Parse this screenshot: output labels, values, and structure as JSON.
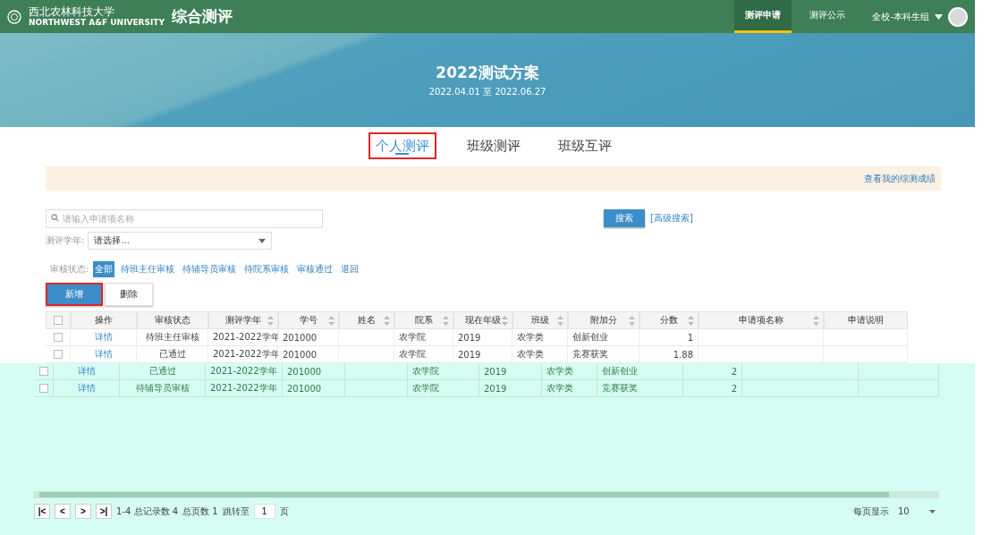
{
  "header": {
    "logo_cn": "西北农林科技大学",
    "logo_en": "NORTHWEST A&F UNIVERSITY",
    "app_title": "综合测评",
    "nav": [
      {
        "label": "测评申请",
        "selected": true
      },
      {
        "label": "测评公示",
        "selected": false
      }
    ],
    "user_group": "全校-本科生组"
  },
  "banner": {
    "title": "2022测试方案",
    "dates": "2022.04.01 至 2022.06.27"
  },
  "tabs": [
    {
      "label": "个人测评",
      "selected": true,
      "highlighted": true
    },
    {
      "label": "班级测评",
      "selected": false,
      "highlighted": false
    },
    {
      "label": "班级互评",
      "selected": false,
      "highlighted": false
    }
  ],
  "notice": {
    "link": "查看我的综测成绩"
  },
  "search": {
    "placeholder": "请输入申请项名称",
    "button": "搜索",
    "advanced": "[高级搜索]"
  },
  "year_filter": {
    "label": "测评学年:",
    "value": "请选择..."
  },
  "status_filter": {
    "label": "审核状态:",
    "options": [
      {
        "label": "全部",
        "selected": true
      },
      {
        "label": "待班主任审核",
        "selected": false
      },
      {
        "label": "待辅导员审核",
        "selected": false
      },
      {
        "label": "待院系审核",
        "selected": false
      },
      {
        "label": "审核通过",
        "selected": false
      },
      {
        "label": "退回",
        "selected": false
      }
    ]
  },
  "actions": [
    {
      "label": "新增",
      "kind": "primary",
      "highlighted": true
    },
    {
      "label": "删除",
      "kind": "default",
      "highlighted": false
    }
  ],
  "table": {
    "select_all_checked": false,
    "columns": [
      {
        "label": "操作",
        "sortable": false
      },
      {
        "label": "审核状态",
        "sortable": false
      },
      {
        "label": "测评学年",
        "sortable": true
      },
      {
        "label": "学号",
        "sortable": true
      },
      {
        "label": "姓名",
        "sortable": true
      },
      {
        "label": "院系",
        "sortable": true
      },
      {
        "label": "现在年级",
        "sortable": true
      },
      {
        "label": "班级",
        "sortable": true
      },
      {
        "label": "附加分",
        "sortable": true
      },
      {
        "label": "分数",
        "sortable": true
      },
      {
        "label": "申请项名称",
        "sortable": true
      },
      {
        "label": "申请说明",
        "sortable": false
      }
    ],
    "rows": [
      {
        "checked": false,
        "tinted": false,
        "cells": [
          "详情",
          "待班主任审核",
          "2021-2022学年",
          "201000",
          "",
          "农学院",
          "2019",
          "农学类",
          "创新创业",
          "1",
          "",
          ""
        ]
      },
      {
        "checked": false,
        "tinted": false,
        "cells": [
          "详情",
          "已通过",
          "2021-2022学年",
          "201000",
          "",
          "农学院",
          "2019",
          "农学类",
          "竞赛获奖",
          "1.88",
          "",
          ""
        ]
      },
      {
        "checked": false,
        "tinted": true,
        "cells": [
          "详情",
          "已通过",
          "2021-2022学年",
          "201000",
          "",
          "农学院",
          "2019",
          "农学类",
          "创新创业",
          "2",
          "",
          ""
        ]
      },
      {
        "checked": false,
        "tinted": true,
        "cells": [
          "详情",
          "待辅导员审核",
          "2021-2022学年",
          "201000",
          "",
          "农学院",
          "2019",
          "农学类",
          "竞赛获奖",
          "2",
          "",
          ""
        ]
      }
    ]
  },
  "pagination": {
    "buttons": [
      "|<",
      "<",
      ">",
      ">|"
    ],
    "summary": "1-4 总记录数 4",
    "pages": "总页数 1",
    "jump_label": "跳转至",
    "page": "1",
    "page_unit": "页",
    "per_page_label": "每页显示",
    "per_page": "10"
  }
}
